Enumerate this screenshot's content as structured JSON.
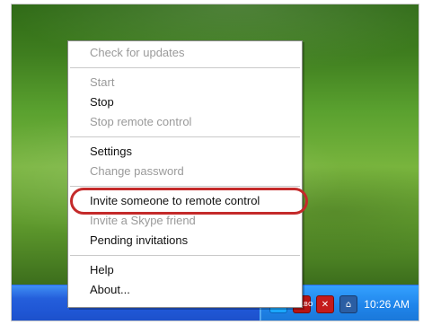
{
  "menu": {
    "items": [
      {
        "label": "Check for updates",
        "enabled": false
      },
      {
        "label": "Start",
        "enabled": false
      },
      {
        "label": "Stop",
        "enabled": true
      },
      {
        "label": "Stop remote control",
        "enabled": false
      },
      {
        "label": "Settings",
        "enabled": true
      },
      {
        "label": "Change password",
        "enabled": false
      },
      {
        "label": "Invite someone to remote control",
        "enabled": true,
        "highlighted": true
      },
      {
        "label": "Invite a Skype friend",
        "enabled": false
      },
      {
        "label": "Pending invitations",
        "enabled": true
      },
      {
        "label": "Help",
        "enabled": true
      },
      {
        "label": "About...",
        "enabled": true
      }
    ]
  },
  "taskbar": {
    "tray": {
      "icons": [
        "skype-icon",
        "turbo-icon",
        "shield-x-icon",
        "network-icon"
      ],
      "time": "10:26 AM",
      "turbo_text": "TURBO"
    }
  },
  "colors": {
    "highlight_ellipse": "#c42a2a",
    "taskbar_blue": "#245edb",
    "tray_blue": "#1f84ea"
  }
}
